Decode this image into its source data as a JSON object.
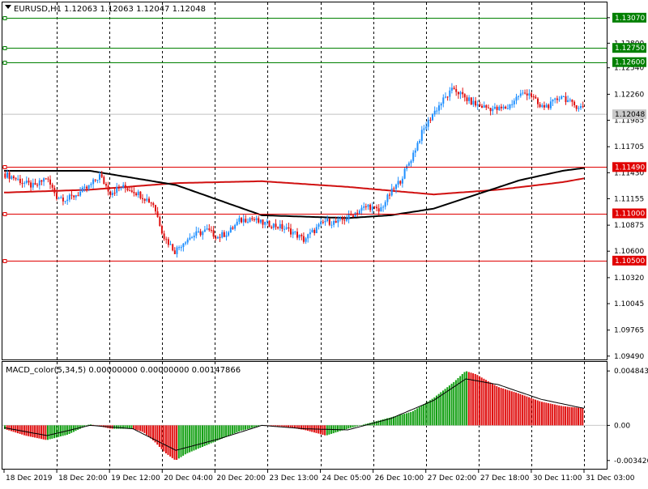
{
  "header": {
    "symbol_label": "EURUSD,H1",
    "ohlc": "1.12063 1.12063 1.12047 1.12048"
  },
  "colors": {
    "bull_candle": "#1e8fff",
    "bear_candle": "#e01010",
    "ma_fast": "#000000",
    "ma_slow": "#d01010",
    "level_green": "#008000",
    "level_red": "#e00000",
    "macd_up": "#14a014",
    "macd_down": "#e01010",
    "signal": "#000000",
    "grid": "#000000"
  },
  "chart_data": [
    {
      "type": "candlestick",
      "title": "EURUSD,H1",
      "ylim": [
        1.0948,
        1.1312
      ],
      "y_ticks": [
        "1.13070",
        "1.12800",
        "1.12540",
        "1.12260",
        "1.11985",
        "1.11705",
        "1.11430",
        "1.11155",
        "1.10875",
        "1.10600",
        "1.10320",
        "1.10045",
        "1.09765",
        "1.09490"
      ],
      "current_price": "1.12048",
      "levels": [
        {
          "value": 1.1307,
          "label": "1.13070",
          "color": "green"
        },
        {
          "value": 1.1275,
          "label": "1.12750",
          "color": "green"
        },
        {
          "value": 1.126,
          "label": "1.12600",
          "color": "green"
        },
        {
          "value": 1.1149,
          "label": "1.11490",
          "color": "red"
        },
        {
          "value": 1.11,
          "label": "1.11000",
          "color": "red"
        },
        {
          "value": 1.105,
          "label": "1.10500",
          "color": "red"
        }
      ],
      "x_labels": [
        "18 Dec 2019",
        "18 Dec 20:00",
        "19 Dec 12:00",
        "20 Dec 04:00",
        "20 Dec 20:00",
        "23 Dec 13:00",
        "24 Dec 05:00",
        "26 Dec 10:00",
        "27 Dec 02:00",
        "27 Dec 18:00",
        "30 Dec 11:00",
        "31 Dec 03:00"
      ],
      "close_path": [
        [
          0,
          1.1142
        ],
        [
          5,
          1.1138
        ],
        [
          10,
          1.1132
        ],
        [
          15,
          1.1128
        ],
        [
          20,
          1.1138
        ],
        [
          25,
          1.1118
        ],
        [
          30,
          1.1115
        ],
        [
          35,
          1.1121
        ],
        [
          40,
          1.1128
        ],
        [
          45,
          1.114
        ],
        [
          50,
          1.1122
        ],
        [
          55,
          1.1128
        ],
        [
          60,
          1.1125
        ],
        [
          65,
          1.1118
        ],
        [
          70,
          1.111
        ],
        [
          75,
          1.1075
        ],
        [
          80,
          1.106
        ],
        [
          85,
          1.1072
        ],
        [
          90,
          1.1078
        ],
        [
          95,
          1.1082
        ],
        [
          100,
          1.1075
        ],
        [
          105,
          1.108
        ],
        [
          110,
          1.1092
        ],
        [
          115,
          1.1095
        ],
        [
          120,
          1.109
        ],
        [
          125,
          1.1088
        ],
        [
          130,
          1.1085
        ],
        [
          135,
          1.108
        ],
        [
          140,
          1.1072
        ],
        [
          145,
          1.1082
        ],
        [
          150,
          1.1092
        ],
        [
          155,
          1.109
        ],
        [
          160,
          1.1095
        ],
        [
          165,
          1.1102
        ],
        [
          170,
          1.1108
        ],
        [
          175,
          1.1102
        ],
        [
          180,
          1.112
        ],
        [
          185,
          1.1135
        ],
        [
          190,
          1.1158
        ],
        [
          195,
          1.1185
        ],
        [
          200,
          1.1205
        ],
        [
          205,
          1.122
        ],
        [
          210,
          1.1232
        ],
        [
          215,
          1.1222
        ],
        [
          220,
          1.1215
        ],
        [
          225,
          1.1212
        ],
        [
          230,
          1.121
        ],
        [
          235,
          1.1212
        ],
        [
          240,
          1.1225
        ],
        [
          245,
          1.1228
        ],
        [
          250,
          1.1212
        ],
        [
          255,
          1.1215
        ],
        [
          260,
          1.1225
        ],
        [
          265,
          1.1215
        ],
        [
          270,
          1.1212
        ]
      ],
      "ma_fast_path": [
        [
          0,
          1.1145
        ],
        [
          40,
          1.1145
        ],
        [
          80,
          1.113
        ],
        [
          120,
          1.1098
        ],
        [
          160,
          1.1095
        ],
        [
          180,
          1.1098
        ],
        [
          200,
          1.1105
        ],
        [
          220,
          1.112
        ],
        [
          240,
          1.1135
        ],
        [
          260,
          1.1145
        ],
        [
          270,
          1.1148
        ]
      ],
      "ma_slow_path": [
        [
          0,
          1.1122
        ],
        [
          40,
          1.1125
        ],
        [
          80,
          1.1132
        ],
        [
          120,
          1.1134
        ],
        [
          160,
          1.1128
        ],
        [
          200,
          1.112
        ],
        [
          230,
          1.1125
        ],
        [
          260,
          1.1133
        ],
        [
          270,
          1.1137
        ]
      ]
    },
    {
      "type": "bar",
      "title": "MACD_color(5,34,5) 0.00000000 0.00000000 0.00147866",
      "ylim": [
        -0.0034,
        0.0051
      ],
      "y_ticks": [
        "0.0048432",
        "0.00",
        "-0.003426"
      ],
      "macd_path": [
        [
          0,
          -0.0003
        ],
        [
          10,
          -0.0009
        ],
        [
          20,
          -0.0013
        ],
        [
          30,
          -0.0008
        ],
        [
          40,
          0.0001
        ],
        [
          50,
          -0.0003
        ],
        [
          60,
          -0.0003
        ],
        [
          65,
          -0.0006
        ],
        [
          70,
          -0.0014
        ],
        [
          75,
          -0.0024
        ],
        [
          80,
          -0.0031
        ],
        [
          85,
          -0.0025
        ],
        [
          90,
          -0.0021
        ],
        [
          100,
          -0.0013
        ],
        [
          110,
          -0.0005
        ],
        [
          120,
          0.0
        ],
        [
          130,
          -0.0001
        ],
        [
          140,
          -0.0004
        ],
        [
          150,
          -0.0009
        ],
        [
          160,
          -0.0003
        ],
        [
          170,
          0.0002
        ],
        [
          180,
          0.0007
        ],
        [
          190,
          0.0012
        ],
        [
          200,
          0.0024
        ],
        [
          210,
          0.0039
        ],
        [
          215,
          0.0048
        ],
        [
          220,
          0.0045
        ],
        [
          230,
          0.0034
        ],
        [
          240,
          0.0028
        ],
        [
          250,
          0.0021
        ],
        [
          260,
          0.0017
        ],
        [
          270,
          0.0015
        ]
      ],
      "signal_path": [
        [
          0,
          -0.0002
        ],
        [
          20,
          -0.0009
        ],
        [
          40,
          0.0
        ],
        [
          60,
          -0.0003
        ],
        [
          80,
          -0.0022
        ],
        [
          100,
          -0.0012
        ],
        [
          120,
          0.0
        ],
        [
          140,
          -0.0003
        ],
        [
          160,
          -0.0004
        ],
        [
          180,
          0.0006
        ],
        [
          200,
          0.0022
        ],
        [
          215,
          0.0041
        ],
        [
          230,
          0.0036
        ],
        [
          250,
          0.0023
        ],
        [
          270,
          0.0015
        ]
      ]
    }
  ]
}
